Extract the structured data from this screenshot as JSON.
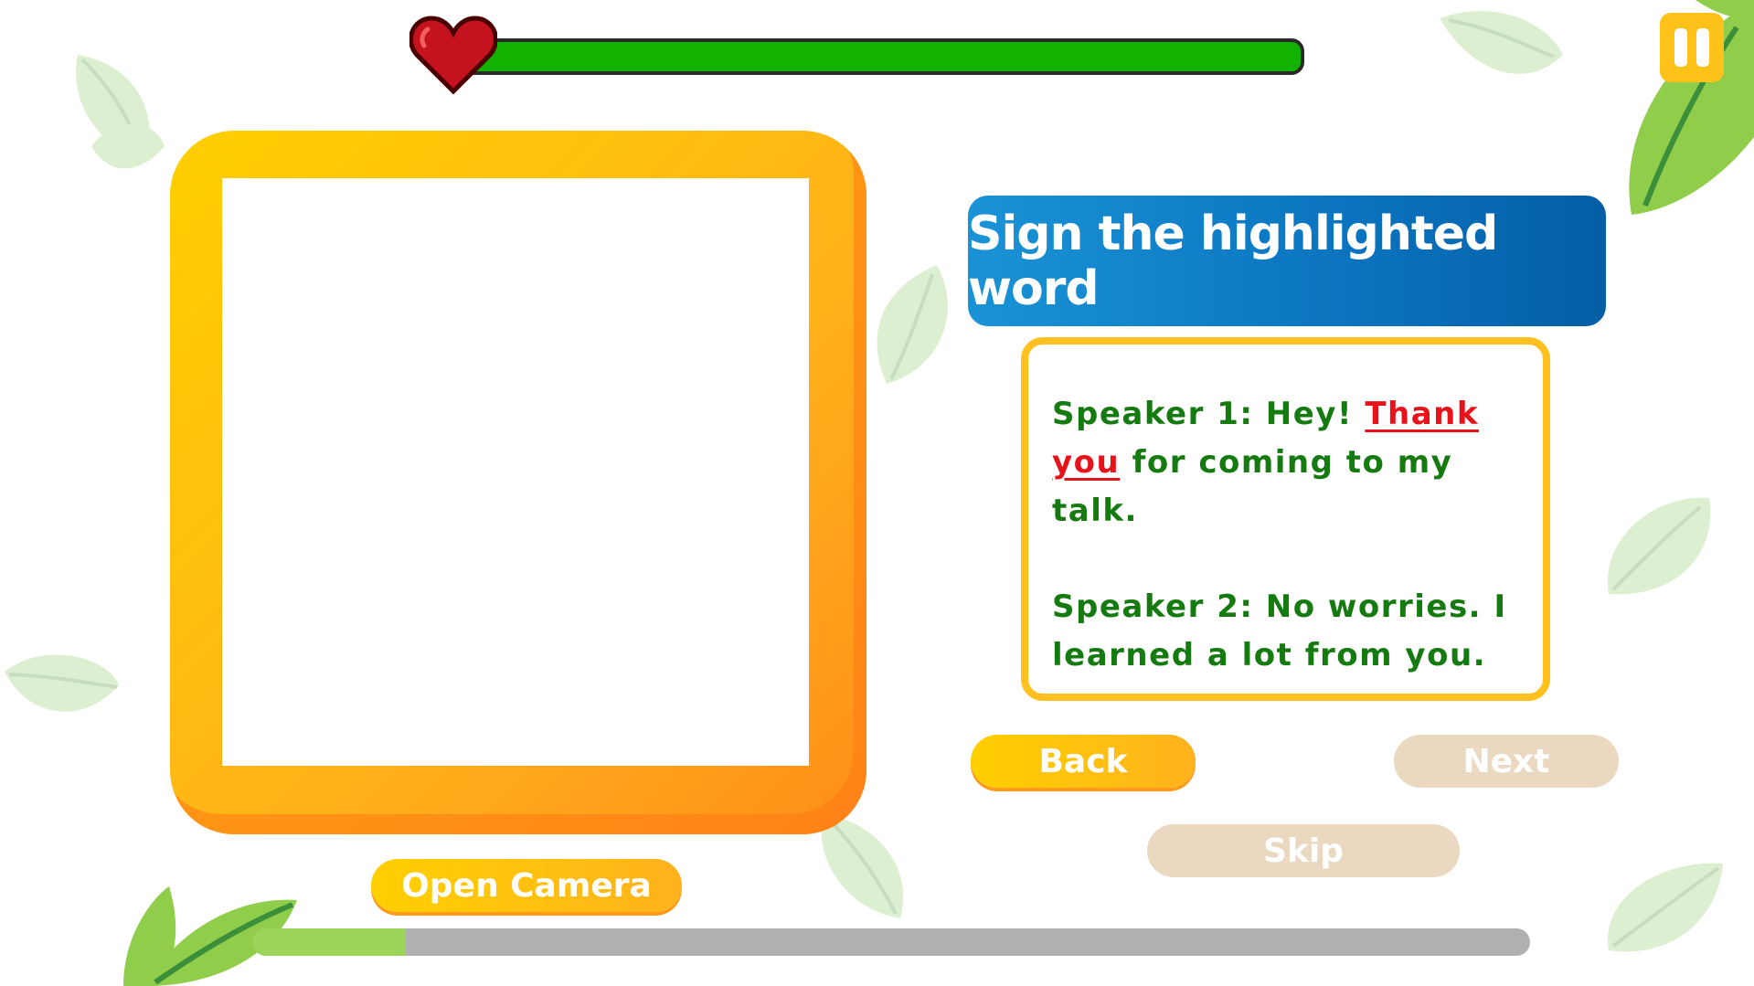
{
  "instruction": "Sign the highlighted word",
  "dialogue": {
    "speaker1": {
      "before": "Speaker 1: Hey! ",
      "highlight": "Thank you",
      "after": " for coming to my talk."
    },
    "speaker2": "Speaker 2: No worries. I learned a lot from you."
  },
  "buttons": {
    "open_camera": "Open Camera",
    "back": "Back",
    "next": "Next",
    "skip": "Skip"
  },
  "health": {
    "fraction": 1.0,
    "color": "#12b300"
  },
  "progress": {
    "fraction": 0.12,
    "color": "#9ad458"
  },
  "colors": {
    "highlight": "#e8121a",
    "dialogue_text": "#157a10",
    "banner": "#0a73bf",
    "accent": "#ffc21a",
    "disabled_button": "#ead8c0"
  },
  "icons": [
    "heart-icon",
    "pause-icon"
  ]
}
